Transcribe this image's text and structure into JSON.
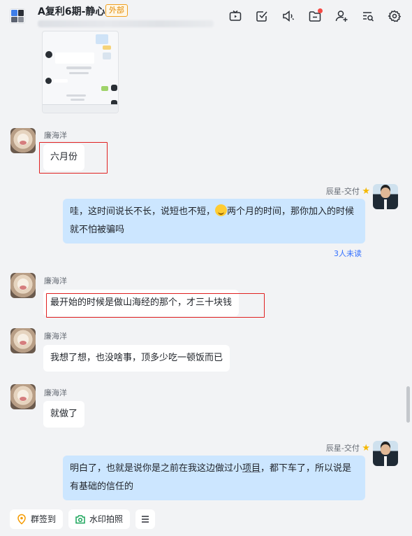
{
  "header": {
    "title": "A复利6期-静心",
    "badge": "外部",
    "icons": [
      "tv-icon",
      "checkbox-icon",
      "speaker-icon",
      "folder-icon",
      "add-member-icon",
      "search-list-icon",
      "gear-icon"
    ]
  },
  "messages": [
    {
      "sender": "廉海洋",
      "text": "六月份",
      "side": "left"
    },
    {
      "sender": "辰星-交付",
      "text_before": "哇，这时间说长不长，说短也不短，",
      "text_after": "两个月的时间，那你加入的时候就不怕被骗吗",
      "read_status": "3人未读",
      "side": "right"
    },
    {
      "sender": "廉海洋",
      "text": "最开始的时候是做山海经的那个，才三十块钱",
      "side": "left"
    },
    {
      "sender": "廉海洋",
      "text": "我想了想，也没啥事，顶多少吃一顿饭而已",
      "side": "left"
    },
    {
      "sender": "廉海洋",
      "text": "就做了",
      "side": "left"
    },
    {
      "sender": "辰星-交付",
      "text_before": "明白了，也就是说你是之前在我这边做过小",
      "text_link": "项目",
      "text_after": "，都下车了，所以说是有基础的信任的",
      "side": "right"
    }
  ],
  "toolbar": {
    "checkin_label": "群签到",
    "photo_label": "水印拍照"
  },
  "colors": {
    "accent": "#3370ff",
    "my_bubble": "#cce6ff",
    "highlight": "#e02020"
  }
}
